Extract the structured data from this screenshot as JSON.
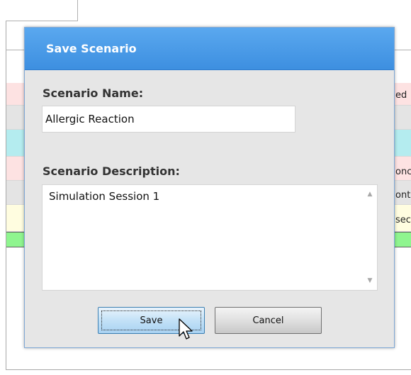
{
  "dialog": {
    "title": "Save Scenario",
    "name_label": "Scenario Name:",
    "name_value": "Allergic Reaction",
    "description_label": "Scenario Description:",
    "description_value": "Simulation Session 1",
    "save_label": "Save",
    "cancel_label": "Cancel"
  },
  "background_table": {
    "rows": [
      {
        "color": "#fde2e2",
        "text": "ed"
      },
      {
        "color": "#e4e4e4",
        "text": ""
      },
      {
        "color": "#b4ecef",
        "text": ""
      },
      {
        "color": "#fde2e2",
        "text": "onc"
      },
      {
        "color": "#e4e4e4",
        "text": "ont"
      },
      {
        "color": "#fffde0",
        "text": "sec"
      },
      {
        "color": "#8ff58f",
        "text": ""
      }
    ]
  },
  "colors": {
    "titlebar": "#4a9ce8",
    "dialog_body": "#e6e6e6",
    "save_button": "#c3e1f7"
  }
}
